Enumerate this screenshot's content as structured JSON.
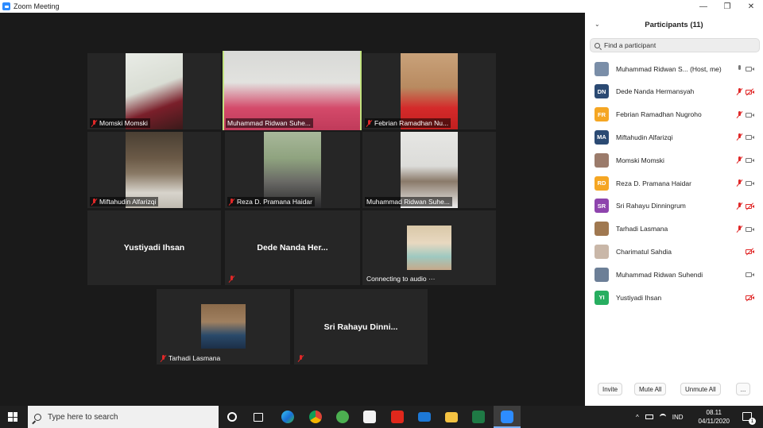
{
  "window": {
    "title": "Zoom Meeting",
    "controls": [
      "—",
      "❐",
      "✕"
    ]
  },
  "tiles": {
    "momski": {
      "name": "Momski Momski"
    },
    "ridwan_active": {
      "name": "Muhammad Ridwan Suhe..."
    },
    "febrian": {
      "name": "Febrian Ramadhan Nu..."
    },
    "miftahudin": {
      "name": "Miftahudin Alfarizqi"
    },
    "reza": {
      "name": "Reza D. Pramana Haidar"
    },
    "ridwan2": {
      "name": "Muhammad Ridwan Suhe..."
    },
    "yustiyadi": {
      "name": "Yustiyadi Ihsan"
    },
    "dede": {
      "name": "Dede Nanda Her..."
    },
    "charimatul": {
      "status": "Connecting to audio ···"
    },
    "tarhadi": {
      "name": "Tarhadi Lasmana"
    },
    "sri": {
      "name": "Sri Rahayu Dinni..."
    }
  },
  "panel": {
    "title": "Participants (11)",
    "search_placeholder": "Find a participant",
    "participants": [
      {
        "name": "Muhammad Ridwan S...  (Host, me)",
        "initials": "",
        "color": "#7a8ea8",
        "mic": "on",
        "video": "on"
      },
      {
        "name": "Dede Nanda Hermansyah",
        "initials": "DN",
        "color": "#2b4a73",
        "mic": "off",
        "video": "off"
      },
      {
        "name": "Febrian Ramadhan Nugroho",
        "initials": "FR",
        "color": "#f5a623",
        "mic": "off",
        "video": "on"
      },
      {
        "name": "Miftahudin Alfarizqi",
        "initials": "MA",
        "color": "#2b4a73",
        "mic": "off",
        "video": "on"
      },
      {
        "name": "Momski Momski",
        "initials": "",
        "color": "#9b7b6b",
        "mic": "off",
        "video": "on"
      },
      {
        "name": "Reza D. Pramana Haidar",
        "initials": "RD",
        "color": "#f5a623",
        "mic": "off",
        "video": "on"
      },
      {
        "name": "Sri Rahayu Dinningrum",
        "initials": "SR",
        "color": "#8e44ad",
        "mic": "off",
        "video": "off"
      },
      {
        "name": "Tarhadi Lasmana",
        "initials": "",
        "color": "#a07850",
        "mic": "off",
        "video": "on"
      },
      {
        "name": "Charimatul Sahdia",
        "initials": "",
        "color": "#c9b7a8",
        "mic": "none",
        "video": "off"
      },
      {
        "name": "Muhammad Ridwan Suhendi",
        "initials": "",
        "color": "#6c7f97",
        "mic": "none",
        "video": "on"
      },
      {
        "name": "Yustiyadi Ihsan",
        "initials": "YI",
        "color": "#27ae60",
        "mic": "none",
        "video": "off"
      }
    ],
    "buttons": {
      "invite": "Invite",
      "mute_all": "Mute All",
      "unmute_all": "Unmute All",
      "more": "..."
    }
  },
  "taskbar": {
    "search_placeholder": "Type here to search",
    "lang": "IND",
    "time": "08.11",
    "date": "04/11/2020",
    "notifications": "1"
  }
}
